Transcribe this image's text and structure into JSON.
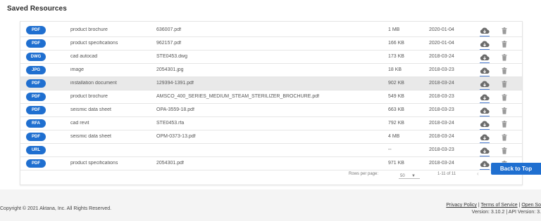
{
  "section_title": "Saved Resources",
  "resources": [
    {
      "badge": "PDF",
      "type": "product brochure",
      "file": "636007.pdf",
      "size": "1 MB",
      "date": "2020-01-04",
      "highlight": false
    },
    {
      "badge": "PDF",
      "type": "product specifications",
      "file": "962157.pdf",
      "size": "166 KB",
      "date": "2020-01-04",
      "highlight": false
    },
    {
      "badge": "DWG",
      "type": "cad autocad",
      "file": "STE0453.dwg",
      "size": "173 KB",
      "date": "2018-03-24",
      "highlight": false
    },
    {
      "badge": "JPG",
      "type": "image",
      "file": "2054301.jpg",
      "size": "18 KB",
      "date": "2018-03-23",
      "highlight": false
    },
    {
      "badge": "PDF",
      "type": "installation document",
      "file": "129394-1391.pdf",
      "size": "902 KB",
      "date": "2018-03-24",
      "highlight": true
    },
    {
      "badge": "PDF",
      "type": "product brochure",
      "file": "AMSCO_400_SERIES_MEDIUM_STEAM_STERILIZER_BROCHURE.pdf",
      "size": "549 KB",
      "date": "2018-03-23",
      "highlight": false
    },
    {
      "badge": "PDF",
      "type": "seismic data sheet",
      "file": "OPA-3559-18.pdf",
      "size": "663 KB",
      "date": "2018-03-23",
      "highlight": false
    },
    {
      "badge": "RFA",
      "type": "cad revit",
      "file": "STE0453.rfa",
      "size": "792 KB",
      "date": "2018-03-24",
      "highlight": false
    },
    {
      "badge": "PDF",
      "type": "seismic data sheet",
      "file": "OPM-0373-13.pdf",
      "size": "4 MB",
      "date": "2018-03-24",
      "highlight": false
    },
    {
      "badge": "URL",
      "type": "",
      "file": "",
      "size": "--",
      "date": "2018-03-23",
      "highlight": false
    },
    {
      "badge": "PDF",
      "type": "product specifications",
      "file": "2054301.pdf",
      "size": "971 KB",
      "date": "2018-03-24",
      "highlight": false
    }
  ],
  "pagination": {
    "rows_per_page_label": "Rows per page:",
    "rows_per_page_value": "50",
    "range_text": "1-11 of 11",
    "prev_symbol": "‹"
  },
  "back_to_top_label": "Back to Top",
  "footer": {
    "copyright": "Copyright © 2021 Aktana, Inc. All Rights Reserved.",
    "privacy_policy": "Privacy Policy",
    "separator": "|",
    "terms_of_service": "Terms of Service",
    "open_source": "Open So",
    "version_text": "Version: 3.10.2 | API Version: 3."
  },
  "colors": {
    "accent_blue": "#1f6fd0",
    "highlight_row": "#e9e9e9"
  },
  "icons": {
    "download": "cloud-download-icon",
    "delete": "trash-icon",
    "dropdown": "caret-down-icon"
  }
}
